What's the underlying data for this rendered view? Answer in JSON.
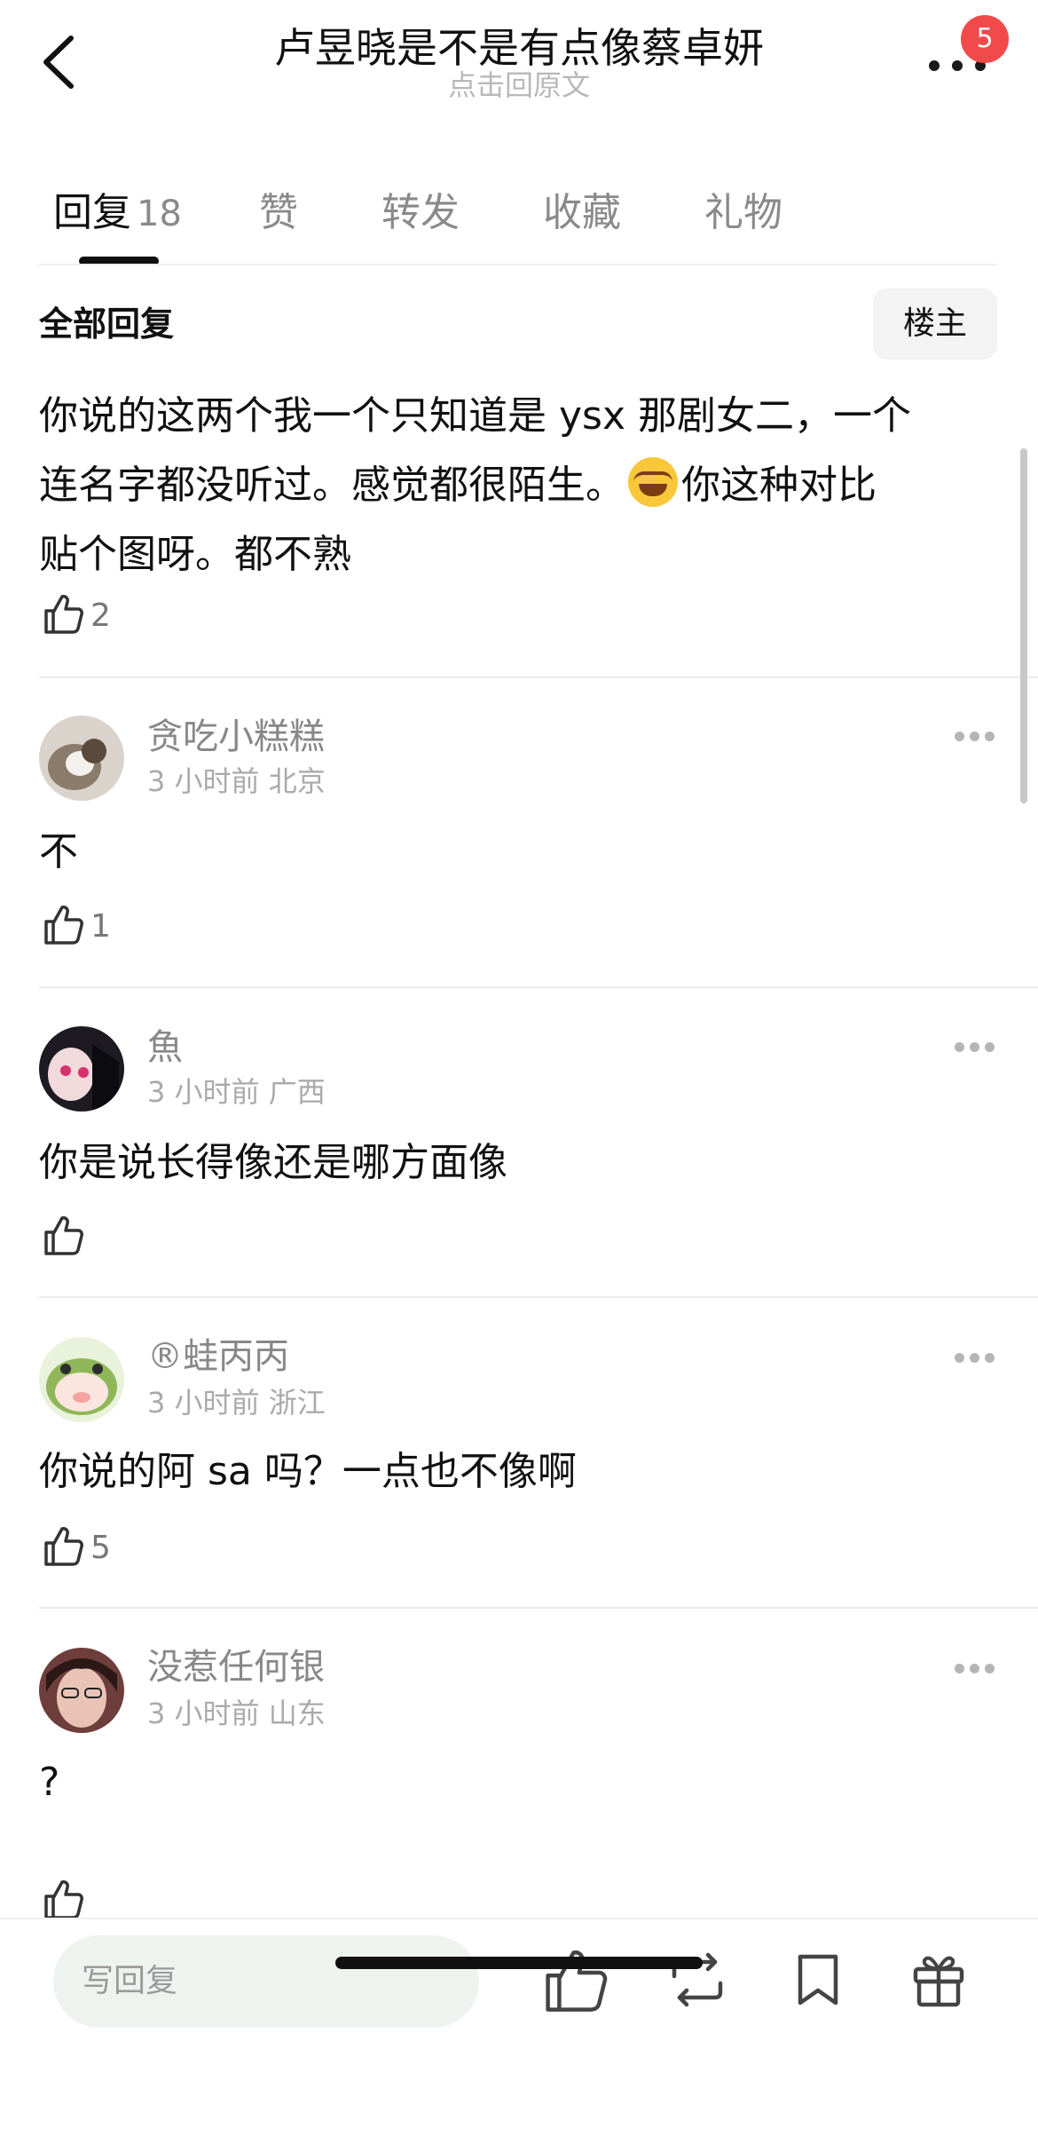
{
  "header": {
    "title": "卢昱晓是不是有点像蔡卓妍",
    "subtitle": "点击回原文",
    "badge_count": "5"
  },
  "tabs": [
    {
      "label": "回复",
      "count": "18"
    },
    {
      "label": "赞"
    },
    {
      "label": "转发"
    },
    {
      "label": "收藏"
    },
    {
      "label": "礼物"
    }
  ],
  "section": {
    "title": "全部回复",
    "sort_button": "楼主"
  },
  "main_comment": {
    "line1": "你说的这两个我一个只知道是 ysx 那剧女二，一个",
    "line2_a": "连名字都没听过。感觉都很陌生。",
    "line2_b": "你这种对比",
    "line3": "贴个图呀。都不熟",
    "emoji": "laughing-tears-emoji",
    "likes": "2"
  },
  "replies": [
    {
      "username": "贪吃小糕糕",
      "time": "3 小时前",
      "location": "北京",
      "text": "不",
      "likes": "1"
    },
    {
      "username": "魚",
      "time": "3 小时前",
      "location": "广西",
      "text": "你是说长得像还是哪方面像",
      "likes": ""
    },
    {
      "username": "®蛙丙丙",
      "time": "3 小时前",
      "location": "浙江",
      "text": "你说的阿 sa 吗？一点也不像啊",
      "likes": "5"
    },
    {
      "username": "没惹任何银",
      "time": "3 小时前",
      "location": "山东",
      "text": "?",
      "likes": ""
    }
  ],
  "bottom_bar": {
    "reply_placeholder": "写回复"
  },
  "colors": {
    "badge": "#f24a4a",
    "input_bg": "#eef3f0",
    "muted_text": "#888888"
  }
}
